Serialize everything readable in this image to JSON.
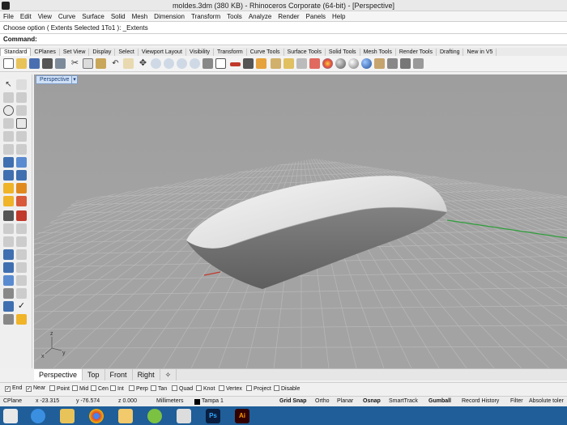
{
  "window": {
    "title": "moldes.3dm (380 KB) - Rhinoceros Corporate (64-bit) - [Perspective]"
  },
  "menu": [
    "File",
    "Edit",
    "View",
    "Curve",
    "Surface",
    "Solid",
    "Mesh",
    "Dimension",
    "Transform",
    "Tools",
    "Analyze",
    "Render",
    "Panels",
    "Help"
  ],
  "command_history": "Choose option ( Extents  Selected  1To1 ): _Extents",
  "command_prompt": "Command:",
  "toolbar_tabs": [
    "Standard",
    "CPlanes",
    "Set View",
    "Display",
    "Select",
    "Viewport Layout",
    "Visibility",
    "Transform",
    "Curve Tools",
    "Surface Tools",
    "Solid Tools",
    "Mesh Tools",
    "Render Tools",
    "Drafting",
    "New in V5"
  ],
  "viewport": {
    "name": "Perspective",
    "axis_x": "x",
    "axis_y": "y",
    "axis_z": "z"
  },
  "view_tabs": [
    "Perspective",
    "Top",
    "Front",
    "Right"
  ],
  "osnaps": [
    {
      "label": "End",
      "checked": true
    },
    {
      "label": "Near",
      "checked": true
    },
    {
      "label": "Point",
      "checked": false
    },
    {
      "label": "Mid",
      "checked": false
    },
    {
      "label": "Cen",
      "checked": false
    },
    {
      "label": "Int",
      "checked": false
    },
    {
      "label": "Perp",
      "checked": false
    },
    {
      "label": "Tan",
      "checked": false
    },
    {
      "label": "Quad",
      "checked": false
    },
    {
      "label": "Knot",
      "checked": false
    },
    {
      "label": "Vertex",
      "checked": false
    },
    {
      "label": "Project",
      "checked": false
    },
    {
      "label": "Disable",
      "checked": false
    }
  ],
  "status": {
    "cplane": "CPlane",
    "x": "x -23.315",
    "y": "y -76.574",
    "z": "z 0.000",
    "units": "Millimeters",
    "layer": "Tampa 1",
    "buttons": [
      "Grid Snap",
      "Ortho",
      "Planar",
      "Osnap",
      "SmartTrack",
      "Gumball",
      "Record History",
      "Filter",
      "Absolute toler"
    ]
  },
  "taskbar_labels": [
    "Ps",
    "Ai"
  ],
  "colors": {
    "viewport_bg": "#a6a6a6",
    "grid_line": "#b8b8b8",
    "x_axis": "#c0392b",
    "y_axis": "#2e9e3a",
    "taskbar": "#1f5e99"
  }
}
